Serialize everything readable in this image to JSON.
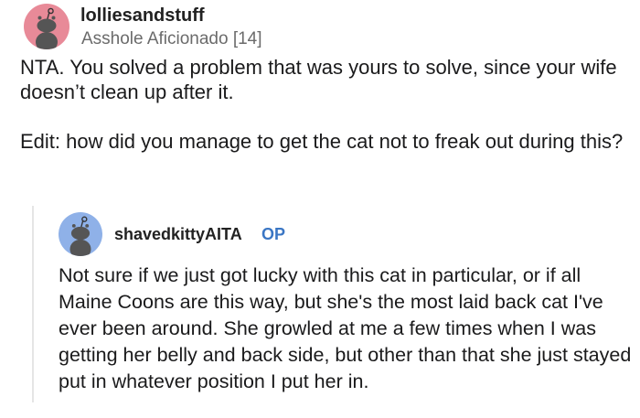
{
  "comment": {
    "username": "lolliesandstuff",
    "flair": "Asshole Aficionado [14]",
    "avatar_color": "#e88a98",
    "avatar_icon": "snoo-avatar-icon",
    "paragraphs": [
      "NTA.  You solved a problem that was yours to solve, since your wife doesn’t clean up after it.",
      "Edit: how did you manage to get the cat not to freak out during this?"
    ]
  },
  "reply": {
    "username": "shavedkittyAITA",
    "badge": "OP",
    "badge_color": "#3a76c4",
    "avatar_color": "#8fb1e8",
    "avatar_icon": "snoo-avatar-icon",
    "body": "Not sure if we just got lucky with this cat in particular, or if all Maine Coons are this way, but she's the most laid back cat I've ever been around. She growled at me a few times when I was getting her belly and back side, but other than that she just stayed put in whatever position I put her in."
  }
}
